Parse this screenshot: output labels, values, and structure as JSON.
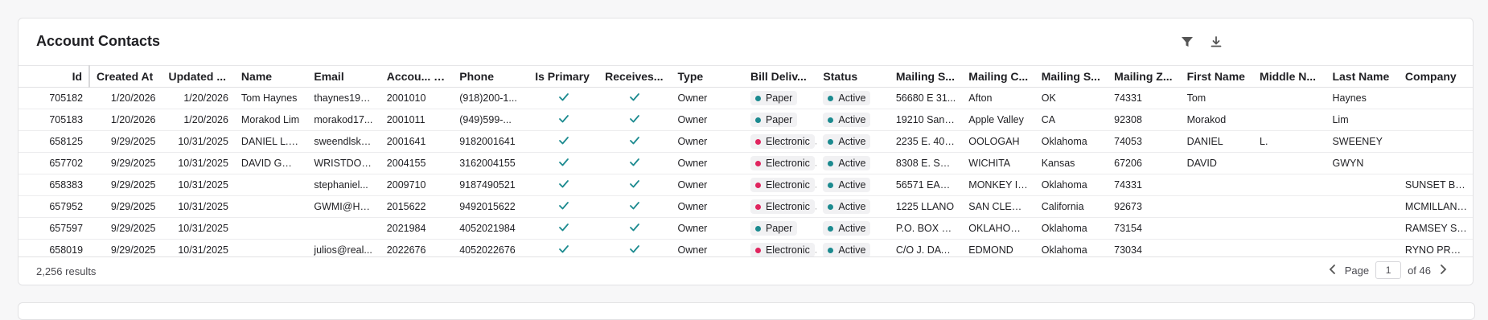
{
  "title": "Account Contacts",
  "colors": {
    "teal": "#1b8a8f",
    "pink": "#e0245e"
  },
  "columns": [
    "Id",
    "Created At",
    "Updated ...",
    "Name",
    "Email",
    "Accou...",
    "Phone",
    "Is Primary",
    "Receives...",
    "Type",
    "Bill Deliv...",
    "Status",
    "Mailing S...",
    "Mailing C...",
    "Mailing S...",
    "Mailing Z...",
    "First Name",
    "Middle N...",
    "Last Name",
    "Company"
  ],
  "rows": [
    {
      "id": "705182",
      "created": "1/20/2026",
      "updated": "1/20/2026",
      "name": "Tom Haynes",
      "email": "thaynes195...",
      "account": "2001010",
      "phone": "(918)200-1...",
      "type": "Owner",
      "bill": "Paper",
      "status": "Active",
      "street": "56680 E 31...",
      "city": "Afton",
      "state": "OK",
      "zip": "74331",
      "first": "Tom",
      "middle": "",
      "last": "Haynes",
      "company": ""
    },
    {
      "id": "705183",
      "created": "1/20/2026",
      "updated": "1/20/2026",
      "name": "Morakod Lim",
      "email": "morakod17...",
      "account": "2001011",
      "phone": "(949)599-...",
      "type": "Owner",
      "bill": "Paper",
      "status": "Active",
      "street": "19210 San J...",
      "city": "Apple Valley",
      "state": "CA",
      "zip": "92308",
      "first": "Morakod",
      "middle": "",
      "last": "Lim",
      "company": ""
    },
    {
      "id": "658125",
      "created": "9/29/2025",
      "updated": "10/31/2025",
      "name": "DANIEL L. S...",
      "email": "sweendlsk1...",
      "account": "2001641",
      "phone": "9182001641",
      "type": "Owner",
      "bill": "Electronic",
      "status": "Active",
      "street": "2235 E. 400...",
      "city": "OOLOGAH",
      "state": "Oklahoma",
      "zip": "74053",
      "first": "DANIEL",
      "middle": "L.",
      "last": "SWEENEY",
      "company": ""
    },
    {
      "id": "657702",
      "created": "9/29/2025",
      "updated": "10/31/2025",
      "name": "DAVID GWYN",
      "email": "WRISTDOC...",
      "account": "2004155",
      "phone": "3162004155",
      "type": "Owner",
      "bill": "Electronic",
      "status": "Active",
      "street": "8308 E. STE...",
      "city": "WICHITA",
      "state": "Kansas",
      "zip": "67206",
      "first": "DAVID",
      "middle": "",
      "last": "GWYN",
      "company": ""
    },
    {
      "id": "658383",
      "created": "9/29/2025",
      "updated": "10/31/2025",
      "name": "",
      "email": "stephaniel...",
      "account": "2009710",
      "phone": "9187490521",
      "type": "Owner",
      "bill": "Electronic",
      "status": "Active",
      "street": "56571 EAST...",
      "city": "MONKEY IS...",
      "state": "Oklahoma",
      "zip": "74331",
      "first": "",
      "middle": "",
      "last": "",
      "company": "SUNSET BA..."
    },
    {
      "id": "657952",
      "created": "9/29/2025",
      "updated": "10/31/2025",
      "name": "",
      "email": "GWMI@HO...",
      "account": "2015622",
      "phone": "9492015622",
      "type": "Owner",
      "bill": "Electronic",
      "status": "Active",
      "street": "1225 LLANO",
      "city": "SAN CLEME...",
      "state": "California",
      "zip": "92673",
      "first": "",
      "middle": "",
      "last": "",
      "company": "MCMILLAN ..."
    },
    {
      "id": "657597",
      "created": "9/29/2025",
      "updated": "10/31/2025",
      "name": "",
      "email": "",
      "account": "2021984",
      "phone": "4052021984",
      "type": "Owner",
      "bill": "Paper",
      "status": "Active",
      "street": "P.O. BOX 18...",
      "city": "OKLAHOMA...",
      "state": "Oklahoma",
      "zip": "73154",
      "first": "",
      "middle": "",
      "last": "",
      "company": "RAMSEY S. ..."
    },
    {
      "id": "658019",
      "created": "9/29/2025",
      "updated": "10/31/2025",
      "name": "",
      "email": "julios@real...",
      "account": "2022676",
      "phone": "4052022676",
      "type": "Owner",
      "bill": "Electronic",
      "status": "Active",
      "street": "C/O J. DAVI...",
      "city": "EDMOND",
      "state": "Oklahoma",
      "zip": "73034",
      "first": "",
      "middle": "",
      "last": "",
      "company": "RYNO PROP..."
    }
  ],
  "footer": {
    "results": "2,256 results",
    "page_label": "Page",
    "page_value": "1",
    "of_label": "of 46"
  }
}
